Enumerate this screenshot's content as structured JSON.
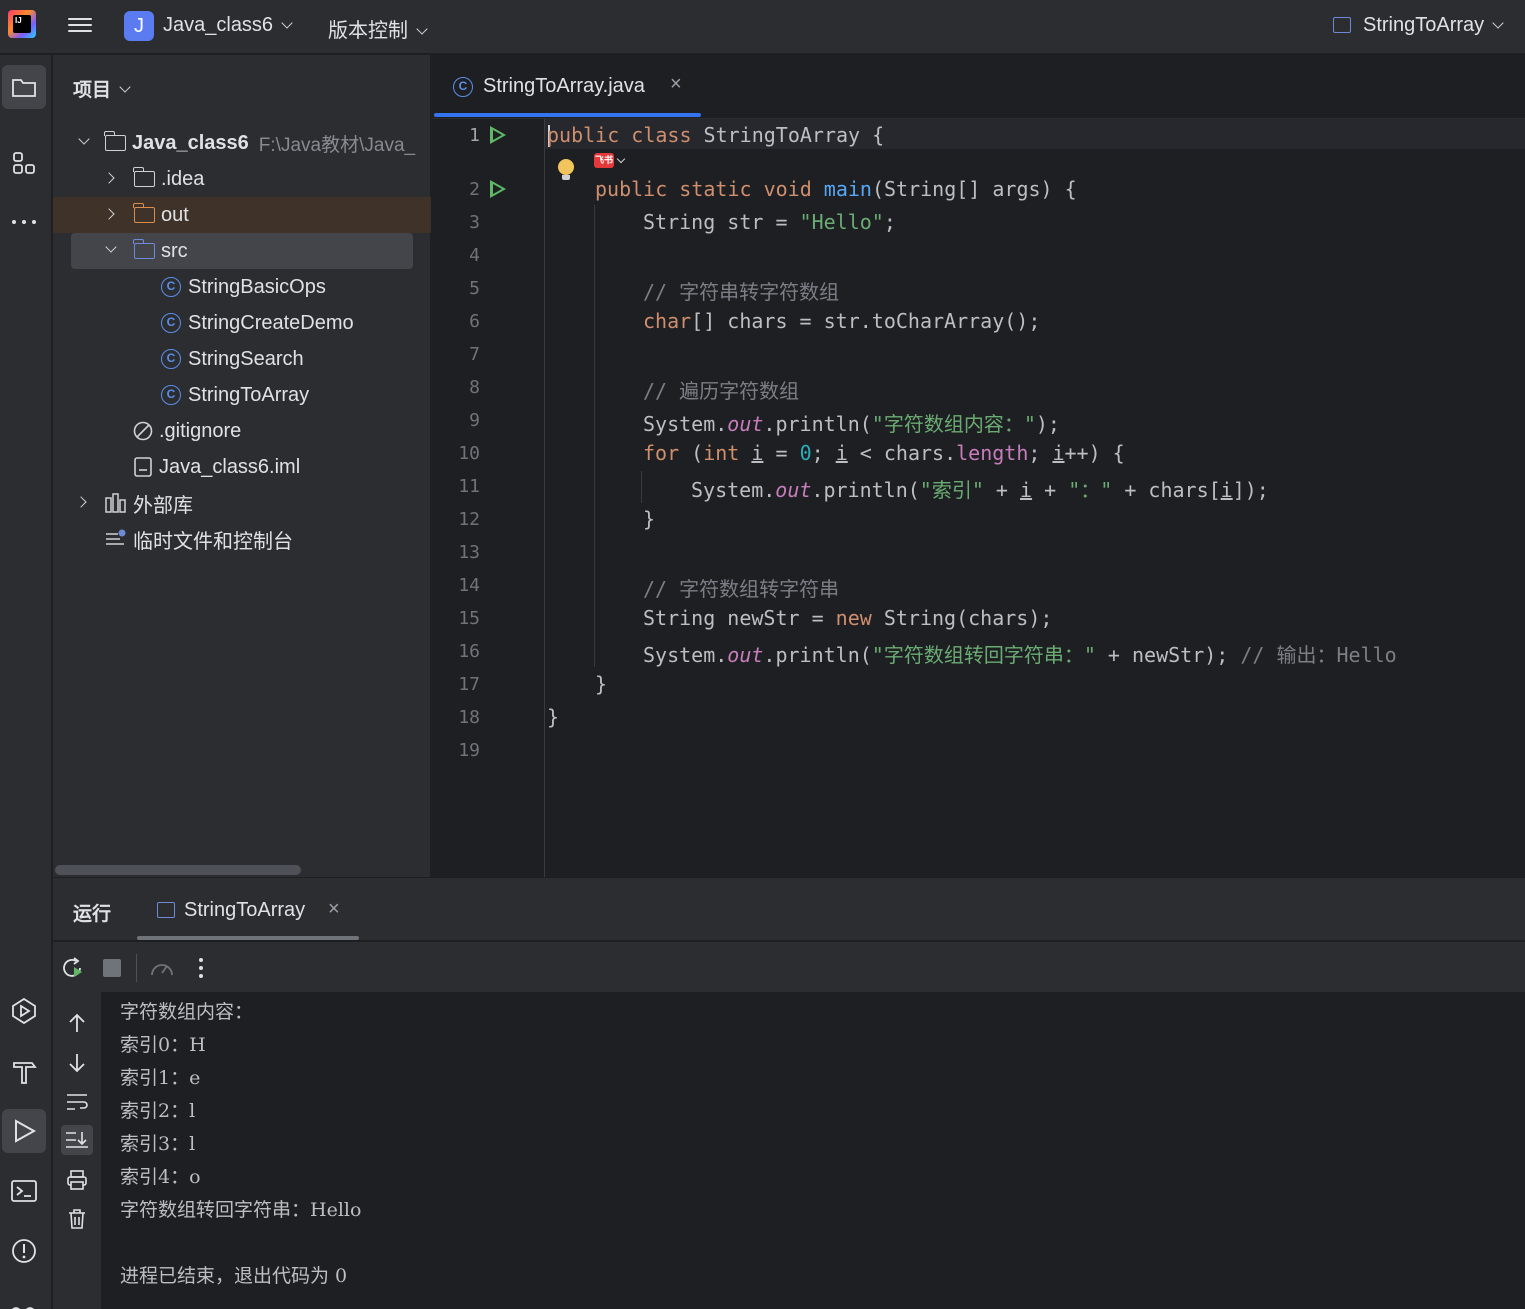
{
  "titlebar": {
    "project_badge": "J",
    "project_name": "Java_class6",
    "vcs": "版本控制",
    "run_config": "StringToArray"
  },
  "project_panel": {
    "title": "项目",
    "root": {
      "name": "Java_class6",
      "path": "F:\\Java教材\\Java_"
    },
    "items": [
      {
        "label": ".idea",
        "kind": "folder"
      },
      {
        "label": "out",
        "kind": "folder-excluded"
      },
      {
        "label": "src",
        "kind": "folder-source"
      },
      {
        "label": "StringBasicOps",
        "kind": "class"
      },
      {
        "label": "StringCreateDemo",
        "kind": "class"
      },
      {
        "label": "StringSearch",
        "kind": "class"
      },
      {
        "label": "StringToArray",
        "kind": "class"
      },
      {
        "label": ".gitignore",
        "kind": "ignore-file"
      },
      {
        "label": "Java_class6.iml",
        "kind": "module-file"
      },
      {
        "label": "外部库",
        "kind": "libraries"
      },
      {
        "label": "临时文件和控制台",
        "kind": "scratches"
      }
    ]
  },
  "editor": {
    "tab_label": "StringToArray.java",
    "tab_close": "×",
    "line_numbers": [
      "1",
      "2",
      "3",
      "4",
      "5",
      "6",
      "7",
      "8",
      "9",
      "10",
      "11",
      "12",
      "13",
      "14",
      "15",
      "16",
      "17",
      "18",
      "19"
    ],
    "inlay_badge": "飞书",
    "code": {
      "l1_kw": "public class",
      "l1_rest": " StringToArray {",
      "l2_kw": "public static void",
      "l2_fn": "main",
      "l2_rest": "(String[] args) {",
      "l3_a": "String str = ",
      "l3_str": "\"Hello\"",
      "l3_b": ";",
      "l5_cm": "// 字符串转字符数组",
      "l6_kw": "char",
      "l6_rest": "[] chars = str.toCharArray();",
      "l8_cm": "// 遍历字符数组",
      "l9_a": "System.",
      "l9_fld": "out",
      "l9_b": ".println(",
      "l9_str": "\"字符数组内容：\"",
      "l9_c": ");",
      "l10_kw": "for",
      "l10_a": " (",
      "l10_kw2": "int",
      "l10_b": " ",
      "l10_i1": "i",
      "l10_c": " = ",
      "l10_num": "0",
      "l10_d": "; ",
      "l10_i2": "i",
      "l10_e": " < chars.",
      "l10_mem": "length",
      "l10_f": "; ",
      "l10_i3": "i",
      "l10_g": "++) {",
      "l11_a": "System.",
      "l11_fld": "out",
      "l11_b": ".println(",
      "l11_str1": "\"索引\"",
      "l11_c": " + ",
      "l11_i1": "i",
      "l11_d": " + ",
      "l11_str2": "\"：\"",
      "l11_e": " + chars[",
      "l11_i2": "i",
      "l11_f": "]);",
      "l12": "}",
      "l14_cm": "// 字符数组转字符串",
      "l15_a": "String newStr = ",
      "l15_kw": "new",
      "l15_b": " String(chars);",
      "l16_a": "System.",
      "l16_fld": "out",
      "l16_b": ".println(",
      "l16_str": "\"字符数组转回字符串：\"",
      "l16_c": " + newStr); ",
      "l16_cm": "// 输出：Hello",
      "l17": "}",
      "l18": "}"
    }
  },
  "run_panel": {
    "title": "运行",
    "tab_label": "StringToArray",
    "tab_close": "×",
    "output": [
      "字符数组内容：",
      "索引0：H",
      "索引1：e",
      "索引2：l",
      "索引3：l",
      "索引4：o",
      "字符数组转回字符串：Hello",
      "",
      "进程已结束，退出代码为 0"
    ]
  },
  "colors": {
    "accent": "#3574f0",
    "run_green": "#5fb865",
    "keyword": "#cf8e6d",
    "string": "#6aab73",
    "comment": "#7a7e85"
  }
}
